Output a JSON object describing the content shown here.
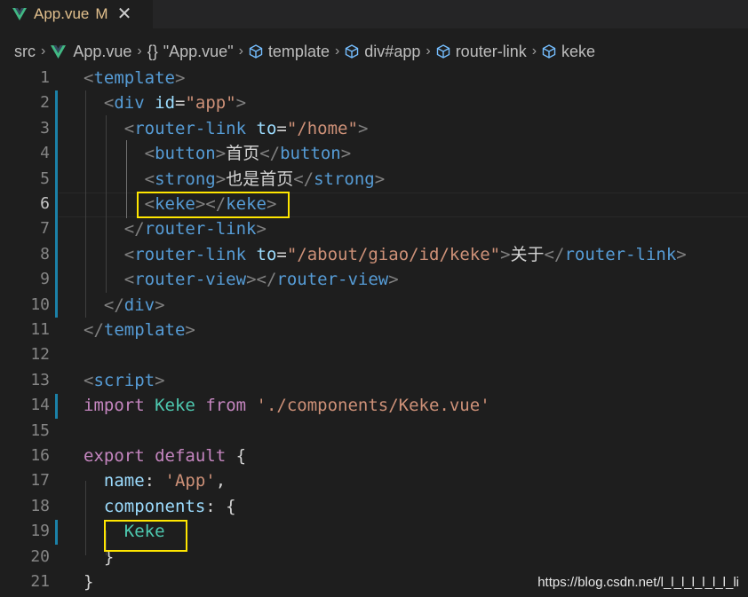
{
  "tab": {
    "title": "App.vue",
    "status": "M",
    "close": "✕"
  },
  "breadcrumb": {
    "items": [
      "src",
      "App.vue",
      "\"App.vue\"",
      "template",
      "div#app",
      "router-link",
      "keke"
    ],
    "braces": "{}"
  },
  "editor": {
    "active_line": 6,
    "lines": [
      {
        "n": "1",
        "tokens": [
          [
            "br",
            "<"
          ],
          [
            "tag",
            "template"
          ],
          [
            "br",
            ">"
          ]
        ]
      },
      {
        "n": "2",
        "tokens": [
          [
            "txt",
            "  "
          ],
          [
            "br",
            "<"
          ],
          [
            "tag",
            "div"
          ],
          [
            "txt",
            " "
          ],
          [
            "attr",
            "id"
          ],
          [
            "txt",
            "="
          ],
          [
            "str",
            "\"app\""
          ],
          [
            "br",
            ">"
          ]
        ]
      },
      {
        "n": "3",
        "tokens": [
          [
            "txt",
            "    "
          ],
          [
            "br",
            "<"
          ],
          [
            "tag",
            "router-link"
          ],
          [
            "txt",
            " "
          ],
          [
            "attr",
            "to"
          ],
          [
            "txt",
            "="
          ],
          [
            "str",
            "\"/home\""
          ],
          [
            "br",
            ">"
          ]
        ]
      },
      {
        "n": "4",
        "tokens": [
          [
            "txt",
            "      "
          ],
          [
            "br",
            "<"
          ],
          [
            "tag",
            "button"
          ],
          [
            "br",
            ">"
          ],
          [
            "txt",
            "首页"
          ],
          [
            "br",
            "</"
          ],
          [
            "tag",
            "button"
          ],
          [
            "br",
            ">"
          ]
        ]
      },
      {
        "n": "5",
        "tokens": [
          [
            "txt",
            "      "
          ],
          [
            "br",
            "<"
          ],
          [
            "tag",
            "strong"
          ],
          [
            "br",
            ">"
          ],
          [
            "txt",
            "也是首页"
          ],
          [
            "br",
            "</"
          ],
          [
            "tag",
            "strong"
          ],
          [
            "br",
            ">"
          ]
        ]
      },
      {
        "n": "6",
        "tokens": [
          [
            "txt",
            "      "
          ],
          [
            "br",
            "<"
          ],
          [
            "tag",
            "keke"
          ],
          [
            "br",
            ">"
          ],
          [
            "br",
            "</"
          ],
          [
            "tag",
            "keke"
          ],
          [
            "br",
            ">"
          ]
        ]
      },
      {
        "n": "7",
        "tokens": [
          [
            "txt",
            "    "
          ],
          [
            "br",
            "</"
          ],
          [
            "tag",
            "router-link"
          ],
          [
            "br",
            ">"
          ]
        ]
      },
      {
        "n": "8",
        "tokens": [
          [
            "txt",
            "    "
          ],
          [
            "br",
            "<"
          ],
          [
            "tag",
            "router-link"
          ],
          [
            "txt",
            " "
          ],
          [
            "attr",
            "to"
          ],
          [
            "txt",
            "="
          ],
          [
            "str",
            "\"/about/giao/id/keke\""
          ],
          [
            "br",
            ">"
          ],
          [
            "txt",
            "关于"
          ],
          [
            "br",
            "</"
          ],
          [
            "tag",
            "router-link"
          ],
          [
            "br",
            ">"
          ]
        ]
      },
      {
        "n": "9",
        "tokens": [
          [
            "txt",
            "    "
          ],
          [
            "br",
            "<"
          ],
          [
            "tag",
            "router-view"
          ],
          [
            "br",
            "></"
          ],
          [
            "tag",
            "router-view"
          ],
          [
            "br",
            ">"
          ]
        ]
      },
      {
        "n": "10",
        "tokens": [
          [
            "txt",
            "  "
          ],
          [
            "br",
            "</"
          ],
          [
            "tag",
            "div"
          ],
          [
            "br",
            ">"
          ]
        ]
      },
      {
        "n": "11",
        "tokens": [
          [
            "br",
            "</"
          ],
          [
            "tag",
            "template"
          ],
          [
            "br",
            ">"
          ]
        ]
      },
      {
        "n": "12",
        "tokens": []
      },
      {
        "n": "13",
        "tokens": [
          [
            "br",
            "<"
          ],
          [
            "tag",
            "script"
          ],
          [
            "br",
            ">"
          ]
        ]
      },
      {
        "n": "14",
        "tokens": [
          [
            "kw",
            "import"
          ],
          [
            "txt",
            " "
          ],
          [
            "comp",
            "Keke"
          ],
          [
            "txt",
            " "
          ],
          [
            "kw",
            "from"
          ],
          [
            "txt",
            " "
          ],
          [
            "str",
            "'./components/Keke.vue'"
          ]
        ]
      },
      {
        "n": "15",
        "tokens": []
      },
      {
        "n": "16",
        "tokens": [
          [
            "kw",
            "export"
          ],
          [
            "txt",
            " "
          ],
          [
            "kw",
            "default"
          ],
          [
            "txt",
            " {"
          ]
        ]
      },
      {
        "n": "17",
        "tokens": [
          [
            "txt",
            "  "
          ],
          [
            "attr",
            "name"
          ],
          [
            "txt",
            ": "
          ],
          [
            "str",
            "'App'"
          ],
          [
            "txt",
            ","
          ]
        ]
      },
      {
        "n": "18",
        "tokens": [
          [
            "txt",
            "  "
          ],
          [
            "attr",
            "components"
          ],
          [
            "txt",
            ": {"
          ]
        ]
      },
      {
        "n": "19",
        "tokens": [
          [
            "txt",
            "    "
          ],
          [
            "comp",
            "Keke"
          ]
        ]
      },
      {
        "n": "20",
        "tokens": [
          [
            "txt",
            "  }"
          ]
        ]
      },
      {
        "n": "21",
        "tokens": [
          [
            "txt",
            "}"
          ]
        ]
      }
    ]
  },
  "watermark": "https://blog.csdn.net/l_l_l_l_l_l_l_li",
  "colors": {
    "gutter_modified": "#1b81a8",
    "highlight_box": "#ffe600",
    "vue_green": "#41b883"
  }
}
